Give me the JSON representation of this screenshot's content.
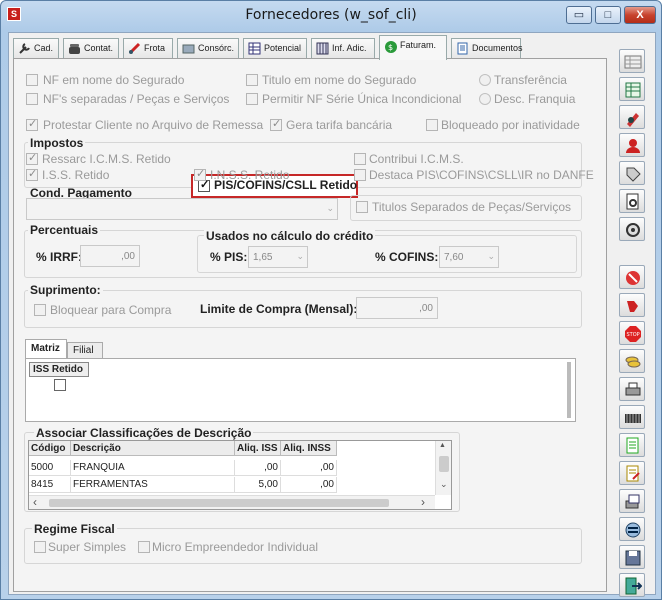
{
  "window": {
    "title": "Fornecedores (w_sof_cli)",
    "app_icon": "S",
    "min": "▭",
    "max": "□",
    "close": "X"
  },
  "tabs": [
    {
      "label": "Cad.",
      "icon": "wrench-icon"
    },
    {
      "label": "Contat.",
      "icon": "phone-icon"
    },
    {
      "label": "Frota",
      "icon": "truck-icon"
    },
    {
      "label": "Consórc.",
      "icon": "card-icon"
    },
    {
      "label": "Potencial",
      "icon": "table-icon"
    },
    {
      "label": "Inf. Adic.",
      "icon": "grid-icon"
    },
    {
      "label": "Faturam.",
      "icon": "money-bag-icon"
    },
    {
      "label": "Documentos",
      "icon": "document-icon"
    }
  ],
  "options": {
    "nf_segurado": "NF em nome do Segurado",
    "titulo_segurado": "Titulo em nome do Segurado",
    "transferencia": "Transferência",
    "nfs_separadas": "NF's separadas / Peças e Serviços",
    "permitir_nf": "Permitir NF Série Única Incondicional",
    "desc_franquia": "Desc. Franquia",
    "protestar": "Protestar Cliente no Arquivo de Remessa",
    "gera_tarifa": "Gera tarifa bancária",
    "bloqueado": "Bloqueado por inatividade"
  },
  "impostos": {
    "title": "Impostos",
    "ressarc_icms": "Ressarc I.C.M.S. Retido",
    "pis_cofins": "PIS/COFINS/CSLL Retido",
    "contribui_icms": "Contribui I.C.M.S.",
    "iss_retido": "I.S.S. Retido",
    "inss_retido": "I.N.S.S. Retido",
    "destaca": "Destaca PIS\\COFINS\\CSLL\\IR no DANFE"
  },
  "cond_pagamento": {
    "title": "Cond. Pagamento",
    "value": "",
    "arrow": "⌄",
    "titulos_separados": "Titulos Separados de Peças/Serviços"
  },
  "percentuais": {
    "title": "Percentuais",
    "irrf_label": "% IRRF:",
    "irrf_value": ",00",
    "usados_title": "Usados no cálculo do crédito",
    "pis_label": "% PIS:",
    "pis_value": "1,65",
    "cofins_label": "% COFINS:",
    "cofins_value": "7,60",
    "arrow": "⌄"
  },
  "suprimento": {
    "title": "Suprimento:",
    "bloquear": "Bloquear para Compra",
    "limite_label": "Limite de Compra (Mensal):",
    "limite_value": ",00"
  },
  "subtabs": {
    "matriz": "Matriz",
    "filial": "Filial",
    "iss_header": "ISS Retido"
  },
  "associar": {
    "title": "Associar Classificações de Descrição",
    "headers": [
      "Código",
      "Descrição",
      "Aliq. ISS",
      "Aliq. INSS"
    ],
    "rows": [
      {
        "codigo": "5000",
        "descricao": "FRANQUIA",
        "iss": ",00",
        "inss": ",00"
      },
      {
        "codigo": "8415",
        "descricao": "FERRAMENTAS",
        "iss": "5,00",
        "inss": ",00"
      }
    ],
    "scroll_up": "▲",
    "scroll_down": "⌄",
    "scroll_left": "‹",
    "scroll_right": "›"
  },
  "regime": {
    "title": "Regime Fiscal",
    "super_simples": "Super Simples",
    "mei": "Micro Empreendedor Individual"
  },
  "toolbar_icons": [
    "grid-edit-icon",
    "spreadsheet-icon",
    "pen-icon",
    "user-icon",
    "tag-icon",
    "print-preview-icon",
    "camera-icon",
    "cancel-icon",
    "thumbs-down-icon",
    "stop-icon",
    "coins-icon",
    "printer-icon",
    "film-icon",
    "report-icon",
    "report-edit-icon",
    "print-queue-icon",
    "sort-icon",
    "save-icon",
    "exit-icon"
  ]
}
